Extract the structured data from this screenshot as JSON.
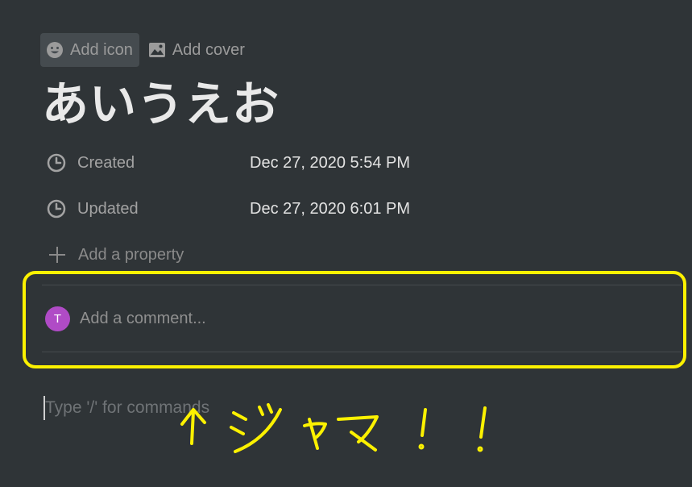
{
  "header": {
    "add_icon_label": "Add icon",
    "add_cover_label": "Add cover"
  },
  "page": {
    "title": "あいうえお"
  },
  "properties": [
    {
      "label": "Created",
      "value": "Dec 27, 2020 5:54 PM",
      "icon": "clock-icon"
    },
    {
      "label": "Updated",
      "value": "Dec 27, 2020 6:01 PM",
      "icon": "clock-icon"
    }
  ],
  "add_property_label": "Add a property",
  "comment": {
    "avatar_initial": "T",
    "avatar_color": "#b04bc6",
    "placeholder": "Add a comment..."
  },
  "editor": {
    "placeholder": "Type '/' for commands"
  },
  "annotation": {
    "text": "↑ジャマ！！",
    "color": "#fcf100"
  }
}
